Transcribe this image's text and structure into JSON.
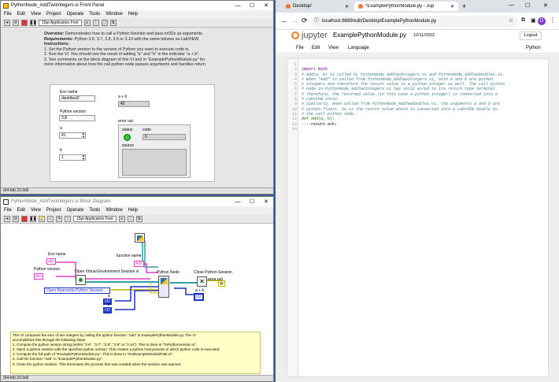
{
  "front_panel": {
    "title": "PythonNode_AddTwoIntegers.vi Front Panel",
    "menus": [
      "File",
      "Edit",
      "View",
      "Project",
      "Operate",
      "Tools",
      "Window",
      "Help"
    ],
    "font": "15pt Application Font",
    "overview_title": "Overview:",
    "overview_text": "Demonstrates how to call a Python function and pass int32s as arguments.",
    "requirements_title": "Requirements:",
    "requirements_text": "Python 3.6, 3.7, 3.8, 3.9 or 3.10 with the same bitness as LabVIEW.",
    "instructions_title": "Instructions:",
    "instruction_1": "1. Set the Python version to the version of Python you want to execute code in.",
    "instruction_2": "2. Run the VI. You should see the result of adding \"a\" and \"b\" in the indicator \"a + b\".",
    "instruction_3": "3. See comments on the block diagram of this VI and in \"ExamplePythonModule.py\" for",
    "instruction_4": "more information about how the call python node passes arguments and handles return",
    "env_name_label": "Env name",
    "env_name_value": "davidtest2",
    "python_version_label": "Python version",
    "python_version_value": "3.8",
    "a_label": "a",
    "a_value": "41",
    "b_label": "b",
    "b_value": "1",
    "sum_label": "a + b",
    "sum_value": "42",
    "error_out_label": "error out",
    "status_label": "status",
    "code_label": "code",
    "code_value": "0",
    "source_label": "source",
    "status_text": "(64-bit) 23.3d2"
  },
  "block_diagram": {
    "title": "PythonNode_AddTwoIntegers.vi Block Diagram",
    "menus": [
      "File",
      "Edit",
      "View",
      "Project",
      "Operate",
      "Tools",
      "Window",
      "Help"
    ],
    "font": "15pt Application Font",
    "env_name": "Env name",
    "python_version": "Python version",
    "open_venv": "Open Virtual Environment Session.vi",
    "function_name": "function name",
    "add_const": "Add",
    "python_node": "Python Node",
    "close_session": "Close Python Session",
    "error_out": "error out",
    "anaconda": "Open Anaconda Python Session",
    "a": "a",
    "b": "b",
    "sum": "a + b",
    "comment": [
      "This VI computes the sum of two integers by calling the python function \"Add\" in ExamplePythonModule.py. The VI",
      "accomplishes this through the following steps:",
      "1. Compute the python version string (either \"3.6\", \"3.7\", \"3.8\", \"3.9\" or \"3.10\"). This is done in \"ToPythonVersion.vi\".",
      "2. Open a python session with the specified python version. This creates a python host process in which python code is executed.",
      "3. Compute the full path of \"ExamplePythonModule.py\". This is done in \"GetExampleModulePath.vi\".",
      "4. Call the function \"Add\" in \"ExamplePythonModule.py\".",
      "5. Close the python session. This terminates the process that was created when the session was opened."
    ],
    "status_text": "(64-bit) 23.3d2"
  },
  "browser": {
    "tabs": [
      {
        "label": "Desktop/"
      },
      {
        "label": "*ExamplePythonModule.py - Jup"
      }
    ],
    "url": "localhost:8889/edit/Desktop/ExamplePythonModule.py",
    "avatar": "D",
    "app": "jupyter",
    "filename": "ExamplePythonModule.py",
    "date": "12/11/2022",
    "logout": "Logout",
    "menus": [
      "File",
      "Edit",
      "View",
      "Language"
    ],
    "language": "Python",
    "lines": [
      "import math",
      "",
      "# Add(a, b) is called by PythonNode_AddTwoIntegers.vi and PythonNode_AddTwoDoubles.vi.",
      "# When \"Add\" is called from PythonNode_AddTwoIntegers.vi, both a and b are python",
      "# integers and therefore the return value is a python integer as well. The call python",
      "# node in PythonNode_AddTwoIntegers.vi has int32 wired to its return type terminal.",
      "# Therefore, the returned value (in this case a python integer) is converted into a",
      "# LabVIEW int32.",
      "# Similarly, when called from PythonNode_AddTwoDoubles.vi, the arguments a and b are",
      "# python floats. So is the return value which is converted into a LabVIEW double by",
      "# the call python node.",
      "def Add(a, b):",
      "····return a+b;",
      ""
    ]
  },
  "colors": {
    "accent": "#f37626",
    "int_wire": "#1d32c6",
    "path_wire": "#30a0a0",
    "string_wire": "#e040c0",
    "error_wire": "#c8b400"
  }
}
